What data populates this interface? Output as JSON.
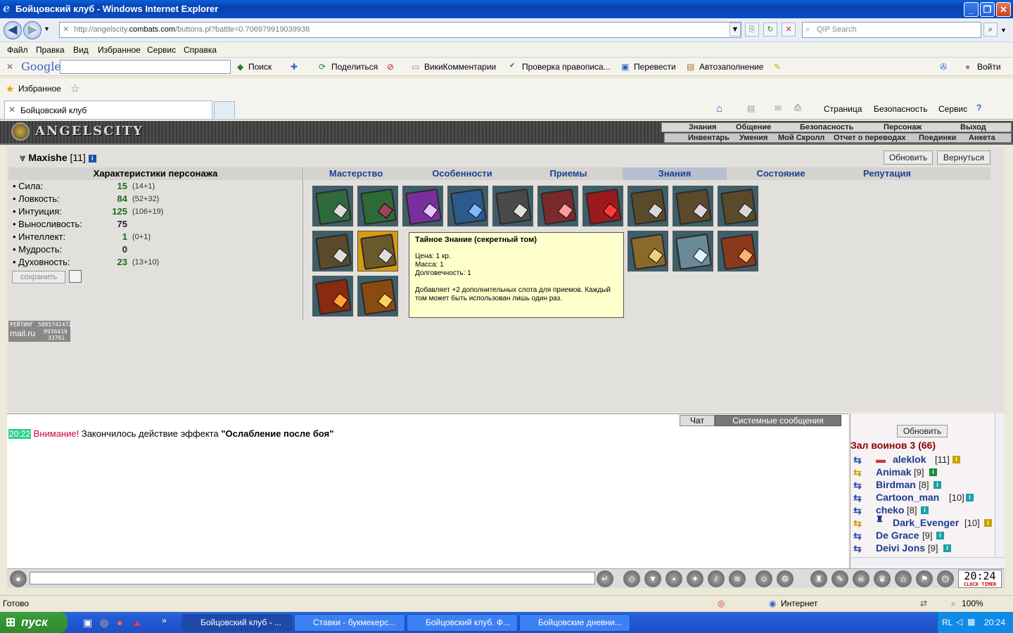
{
  "window": {
    "title": "Бойцовский клуб - Windows Internet Explorer"
  },
  "browser": {
    "url_prefix": "http://angelscity.",
    "url_domain": "combats.com",
    "url_rest": "/buttons.pl?battle=0.706979919039938",
    "search_placeholder": "QIP Search",
    "menu": [
      "Файл",
      "Правка",
      "Вид",
      "Избранное",
      "Сервис",
      "Справка"
    ],
    "google_label": "Google",
    "google_toolbar": [
      "Поиск",
      "Поделиться",
      "ВикиКомментарии",
      "Проверка правописа...",
      "Перевести",
      "Автозаполнение",
      "Войти"
    ],
    "favorites_label": "Избранное",
    "tab_title": "Бойцовский клуб",
    "cmd_items": [
      "Страница",
      "Безопасность",
      "Сервис"
    ]
  },
  "game": {
    "logo": "ANGELSCITY",
    "nav_top": [
      "Знания",
      "Общение",
      "Безопасность",
      "Персонаж",
      "Выход"
    ],
    "nav_bottom": [
      "Инвентарь",
      "Умения",
      "Мой Скролл",
      "Отчет о переводах",
      "Поединки",
      "Анкета"
    ],
    "char_name": "Maxishe",
    "char_level": "[11]",
    "refresh_btn": "Обновить",
    "back_btn": "Вернуться",
    "stats_title": "Характеристики персонажа",
    "stats": [
      {
        "name": "• Сила:",
        "value": "15",
        "detail": "(14+1)"
      },
      {
        "name": "• Ловкость:",
        "value": "84",
        "detail": "(52+32)"
      },
      {
        "name": "• Интуиция:",
        "value": "125",
        "detail": "(106+19)"
      },
      {
        "name": "• Выносливость:",
        "value": "75",
        "detail": ""
      },
      {
        "name": "• Интеллект:",
        "value": "1",
        "detail": "(0+1)"
      },
      {
        "name": "• Мудрость:",
        "value": "0",
        "detail": ""
      },
      {
        "name": "• Духовность:",
        "value": "23",
        "detail": "(13+10)"
      }
    ],
    "save_btn": "сохранить",
    "tabs": [
      "Мастерство",
      "Особенности",
      "Приемы",
      "Знания",
      "Состояние",
      "Репутация"
    ],
    "active_tab": "Знания",
    "tooltip": {
      "title": "Тайное Знание (секретный том)",
      "price": "Цена: 1 кр.",
      "mass": "Масса: 1",
      "durability": "Долговечность: 1",
      "desc": "Добавляет +2 дополнительных слота для приемов. Каждый том может быть использован лишь один раз."
    },
    "rating": {
      "label": "РЕЙТИНГ",
      "n1": "5885742472",
      "n2": "9936419",
      "n3": "33761",
      "brand": "mail.ru"
    }
  },
  "chat": {
    "tab_chat": "Чат",
    "tab_system": "Системные сообщения",
    "time": "20:22",
    "warn": "Внимание!",
    "msg": "Закончилось действие эффекта",
    "effect": "\"Ослабление после боя\""
  },
  "room": {
    "refresh": "Обновить",
    "title": "Зал воинов 3 (66)",
    "users": [
      {
        "name": "aleklok",
        "level": "[11]"
      },
      {
        "name": "Animak",
        "level": "[9]"
      },
      {
        "name": "Birdman",
        "level": "[8]"
      },
      {
        "name": "Cartoon_man",
        "level": "[10]"
      },
      {
        "name": "cheko",
        "level": "[8]"
      },
      {
        "name": "Dark_Evenger",
        "level": "[10]"
      },
      {
        "name": "De Grace",
        "level": "[9]"
      },
      {
        "name": "Deivi Jons",
        "level": "[9]"
      }
    ]
  },
  "clock": {
    "time": "20:24",
    "label": "CLOCK TIMER"
  },
  "status": {
    "ready": "Готово",
    "zone": "Интернет",
    "zoom": "100%"
  },
  "taskbar": {
    "start": "пуск",
    "tasks": [
      "Бойцовский клуб - ...",
      "Ставки - букмекерс...",
      "Бойцовский клуб. Ф...",
      "Бойцовские дневни..."
    ],
    "lang": "RL",
    "time": "20:24"
  },
  "colors": {
    "accent": "#1c3f8e",
    "stat_value": "#1b6a1b",
    "warn": "#cc0033",
    "tooltip_bg": "#ffffcc"
  }
}
